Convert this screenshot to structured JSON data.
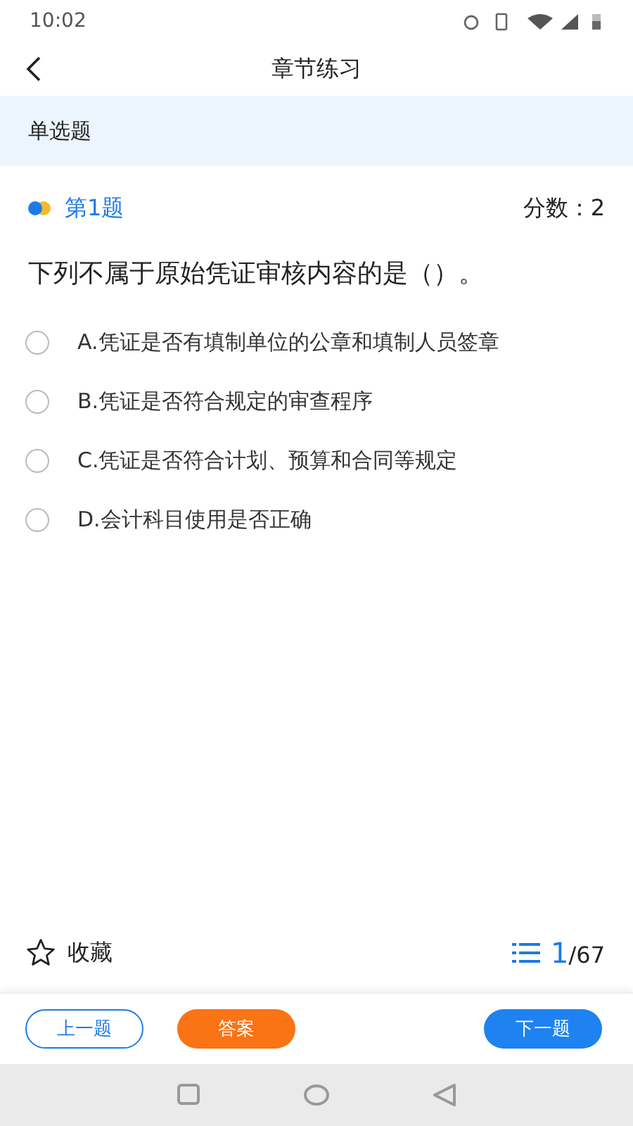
{
  "status_bar": {
    "time": "10:02"
  },
  "header": {
    "title": "章节练习"
  },
  "section": {
    "label": "单选题"
  },
  "question": {
    "number": "第1题",
    "score": "分数：2",
    "stem": "下列不属于原始凭证审核内容的是（）。",
    "options": [
      {
        "text": "A.凭证是否有填制单位的公章和填制人员签章",
        "selected": false
      },
      {
        "text": "B.凭证是否符合规定的审查程序",
        "selected": false
      },
      {
        "text": "C.凭证是否符合计划、预算和合同等规定",
        "selected": false
      },
      {
        "text": "D.会计科目使用是否正确",
        "selected": false
      }
    ]
  },
  "favorite": {
    "label": "收藏",
    "on": false
  },
  "progress": {
    "current": "1",
    "total": "/67"
  },
  "buttons": {
    "previous": "上一题",
    "answer": "答案",
    "next": "下一题"
  }
}
